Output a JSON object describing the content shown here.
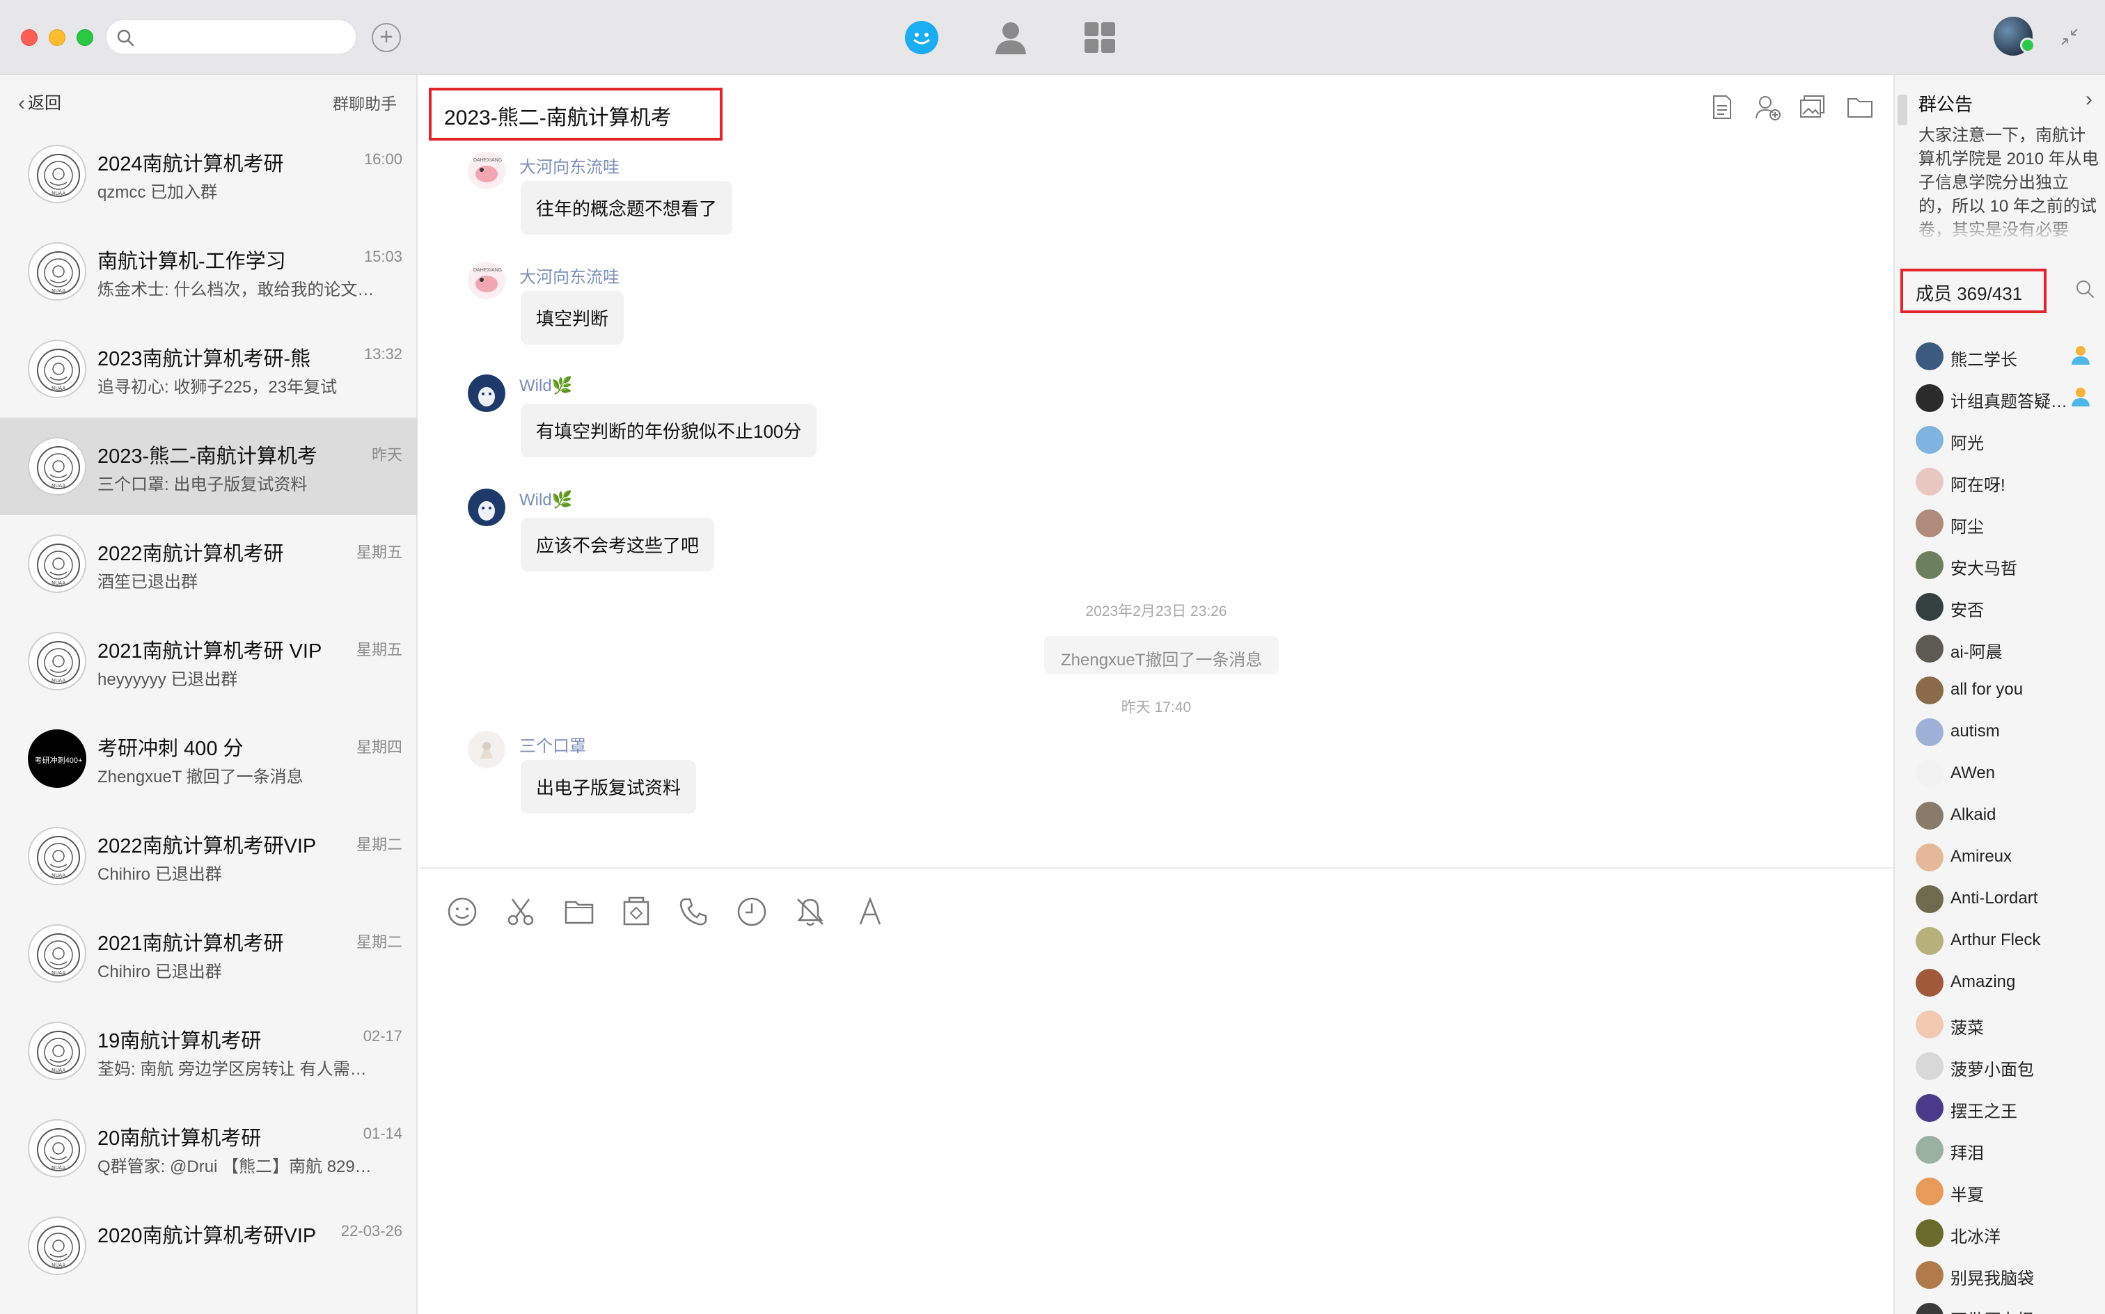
{
  "titlebar": {
    "search_placeholder": "",
    "plus_label": "+"
  },
  "left": {
    "back_label": "返回",
    "assistant_label": "群聊助手",
    "conversations": [
      {
        "name": "2024南航计算机考研",
        "time": "16:00",
        "preview": "qzmcc 已加入群",
        "avatar": "nuaa"
      },
      {
        "name": "南航计算机-工作学习",
        "time": "15:03",
        "preview": "炼金术士: 什么档次，敢给我的论文…",
        "avatar": "nuaa"
      },
      {
        "name": "2023南航计算机考研-熊",
        "time": "13:32",
        "preview": "追寻初心: 收狮子225，23年复试",
        "avatar": "nuaa"
      },
      {
        "name": "2023-熊二-南航计算机考",
        "time": "昨天",
        "preview": "三个口罩: 出电子版复试资料",
        "avatar": "nuaa"
      },
      {
        "name": "2022南航计算机考研",
        "time": "星期五",
        "preview": "酒笙已退出群",
        "avatar": "nuaa"
      },
      {
        "name": "2021南航计算机考研 VIP",
        "time": "星期五",
        "preview": "heyyyyyy 已退出群",
        "avatar": "nuaa"
      },
      {
        "name": "考研冲刺 400 分",
        "time": "星期四",
        "preview": "ZhengxueT 撤回了一条消息",
        "avatar": "black",
        "avatar_text": "考研冲刺400+"
      },
      {
        "name": "2022南航计算机考研VIP",
        "time": "星期二",
        "preview": "Chihiro 已退出群",
        "avatar": "nuaa"
      },
      {
        "name": "2021南航计算机考研",
        "time": "星期二",
        "preview": "Chihiro 已退出群",
        "avatar": "nuaa"
      },
      {
        "name": "19南航计算机考研",
        "time": "02-17",
        "preview": "荃妈: 南航 旁边学区房转让 有人需…",
        "avatar": "nuaa"
      },
      {
        "name": "20南航计算机考研",
        "time": "01-14",
        "preview": "Q群管家: @Drui 【熊二】南航 829…",
        "avatar": "nuaa"
      },
      {
        "name": "2020南航计算机考研VIP",
        "time": "22-03-26",
        "preview": "",
        "avatar": "nuaa"
      }
    ],
    "active_index": 3
  },
  "chat": {
    "title": "2023-熊二-南航计算机考",
    "messages": [
      {
        "sender": "大河向东流哇",
        "text": "往年的概念题不想看了"
      },
      {
        "sender": "大河向东流哇",
        "text": "填空判断"
      },
      {
        "sender": "Wild🌿",
        "text": "有填空判断的年份貌似不止100分"
      },
      {
        "sender": "Wild🌿",
        "text": "应该不会考这些了吧"
      },
      {
        "sender": "三个口罩",
        "text": "出电子版复试资料"
      }
    ],
    "system": {
      "time1": "2023年2月23日  23:26",
      "notice": "ZhengxueT撤回了一条消息",
      "time2": "昨天  17:40"
    },
    "toolbar": [
      "emoji-icon",
      "scissors-icon",
      "folder-icon",
      "screenshot-icon",
      "phone-icon",
      "clock-icon",
      "bell-off-icon",
      "font-icon"
    ]
  },
  "right": {
    "notice_title": "群公告",
    "notice_body": "大家注意一下，南航计算机学院是 2010 年从电子信息学院分出独立的，所以 10 年之前的试卷，其实是没有必要",
    "member_header": "成员 369/431",
    "members": [
      {
        "name": "熊二学长",
        "admin": true,
        "color": "#3d5a80"
      },
      {
        "name": "计组真题答疑…",
        "admin": true,
        "color": "#2b2b2b"
      },
      {
        "name": "阿光",
        "admin": false,
        "color": "#7fb3e0"
      },
      {
        "name": "阿在呀!",
        "admin": false,
        "color": "#e8c7c0"
      },
      {
        "name": "阿尘",
        "admin": false,
        "color": "#b08a7a"
      },
      {
        "name": "安大马哲",
        "admin": false,
        "color": "#6b7f5c"
      },
      {
        "name": "安否",
        "admin": false,
        "color": "#33403f"
      },
      {
        "name": "ai-阿晨",
        "admin": false,
        "color": "#5c5a52"
      },
      {
        "name": "all  for  you",
        "admin": false,
        "color": "#8a6a4a"
      },
      {
        "name": "autism",
        "admin": false,
        "color": "#9fb0d8"
      },
      {
        "name": "AWen",
        "admin": false,
        "color": "#f2f2f2"
      },
      {
        "name": "Alkaid",
        "admin": false,
        "color": "#8a7a6a"
      },
      {
        "name": "Amireux",
        "admin": false,
        "color": "#e6b89a"
      },
      {
        "name": "Anti-Lordart",
        "admin": false,
        "color": "#6f6a4d"
      },
      {
        "name": "Arthur Fleck",
        "admin": false,
        "color": "#b8b07a"
      },
      {
        "name": "Amazing",
        "admin": false,
        "color": "#a05a3a"
      },
      {
        "name": "菠菜",
        "admin": false,
        "color": "#f0c9b0"
      },
      {
        "name": "菠萝小面包",
        "admin": false,
        "color": "#d8d8d8"
      },
      {
        "name": "摆王之王",
        "admin": false,
        "color": "#4a3a8a"
      },
      {
        "name": "拜泪",
        "admin": false,
        "color": "#9ab0a0"
      },
      {
        "name": "半夏",
        "admin": false,
        "color": "#e89a5a"
      },
      {
        "name": "北冰洋",
        "admin": false,
        "color": "#6a6a2a"
      },
      {
        "name": "别晃我脑袋",
        "admin": false,
        "color": "#b07a4a"
      },
      {
        "name": "不做压力怪",
        "admin": false,
        "color": "#3a3a3a"
      }
    ]
  }
}
